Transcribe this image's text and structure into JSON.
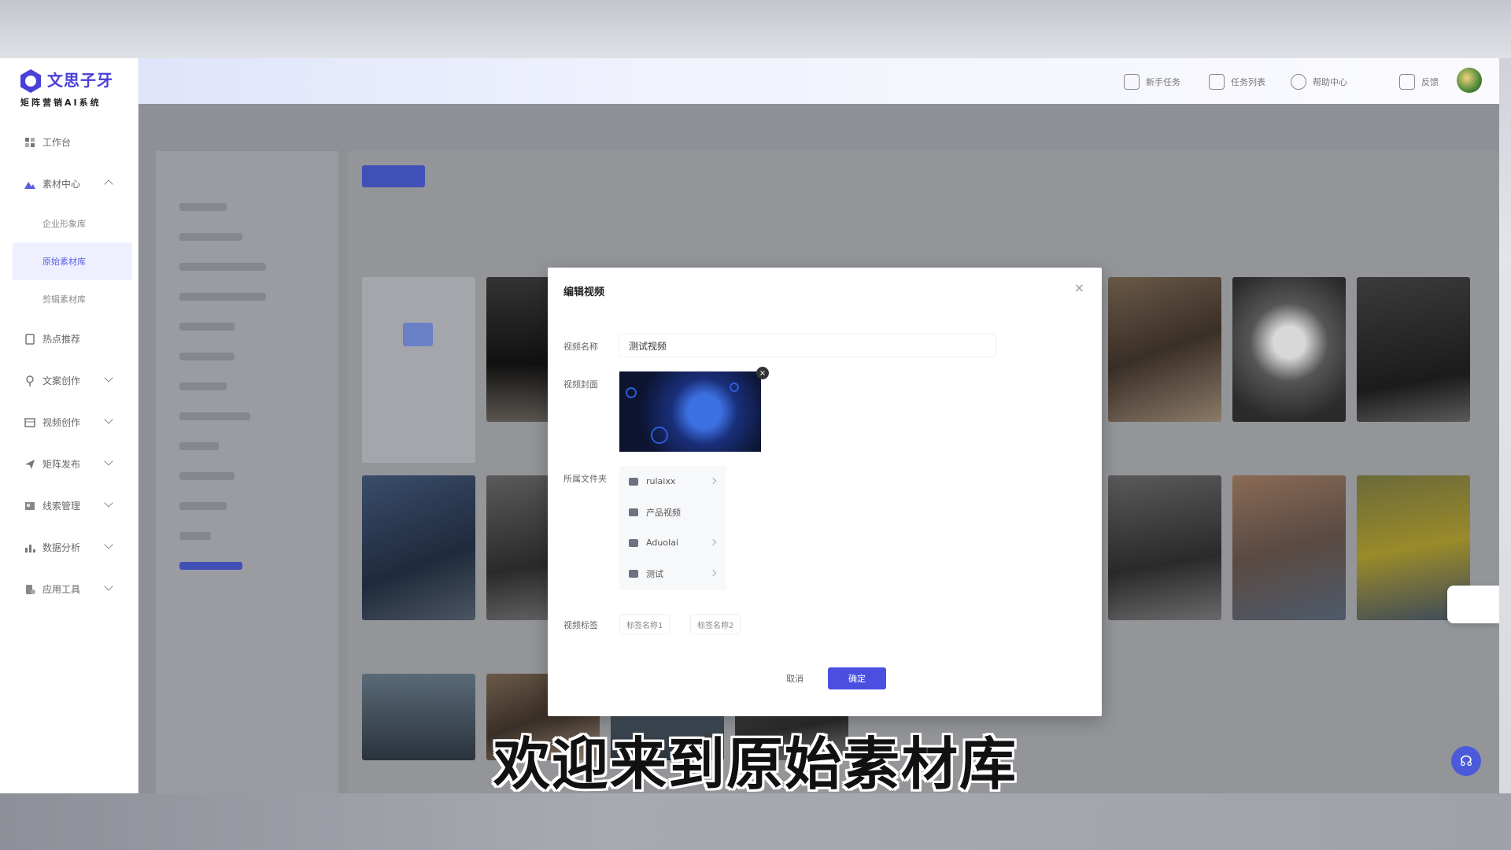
{
  "brand": {
    "name": "文思子牙",
    "subtitle": "矩阵营销AI系统"
  },
  "sidebar": {
    "items": [
      {
        "label": "工作台",
        "icon": "dashboard-icon"
      },
      {
        "label": "素材中心",
        "icon": "image-icon",
        "expanded": true
      },
      {
        "label": "热点推荐",
        "icon": "fire-icon"
      },
      {
        "label": "文案创作",
        "icon": "pen-icon"
      },
      {
        "label": "视频创作",
        "icon": "video-icon"
      },
      {
        "label": "矩阵发布",
        "icon": "send-icon"
      },
      {
        "label": "线索管理",
        "icon": "contacts-icon"
      },
      {
        "label": "数据分析",
        "icon": "chart-icon"
      },
      {
        "label": "应用工具",
        "icon": "tools-icon"
      }
    ],
    "sub_items": [
      {
        "label": "企业形象库",
        "active": false
      },
      {
        "label": "原始素材库",
        "active": true
      },
      {
        "label": "剪辑素材库",
        "active": false
      }
    ]
  },
  "header": {
    "actions": [
      {
        "label": "新手任务",
        "icon": "task-icon"
      },
      {
        "label": "任务列表",
        "icon": "list-icon"
      },
      {
        "label": "帮助中心",
        "icon": "help-icon"
      },
      {
        "label": "反馈",
        "icon": "mail-icon"
      }
    ]
  },
  "modal": {
    "title": "编辑视频",
    "close_glyph": "×",
    "name_label": "视频名称",
    "name_value": "测试视频",
    "cover_label": "视频封面",
    "folder_label": "所属文件夹",
    "folders": [
      {
        "label": "rulaixx"
      },
      {
        "label": "产品视频"
      },
      {
        "label": "Aduolai"
      },
      {
        "label": "测试"
      }
    ],
    "tags_label": "视频标签",
    "tags": [
      "标签名称1",
      "标签名称2"
    ],
    "cancel_label": "取消",
    "confirm_label": "确定"
  },
  "subtitle": "欢迎来到原始素材库",
  "colors": {
    "accent": "#4b4fe0",
    "brand": "#4a3fd6"
  }
}
